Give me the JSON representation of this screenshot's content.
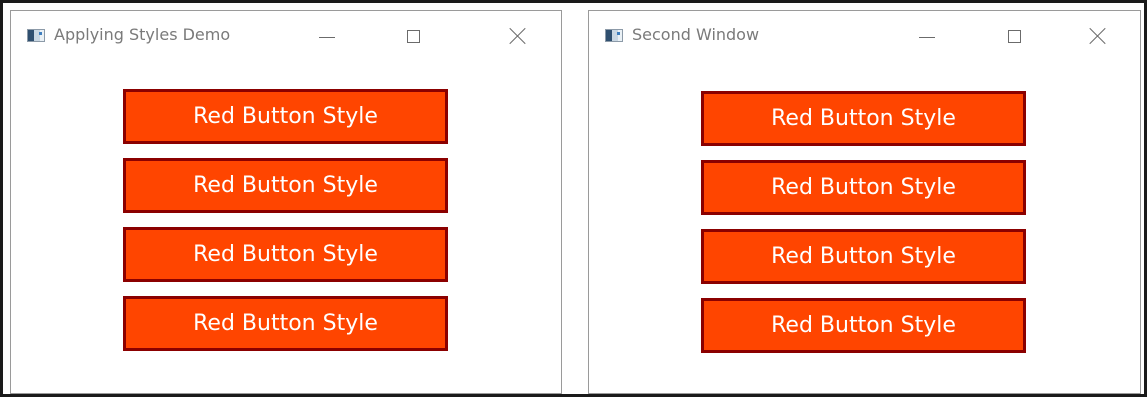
{
  "windows": [
    {
      "title": "Applying Styles Demo",
      "buttons": [
        {
          "label": "Red Button Style"
        },
        {
          "label": "Red Button Style"
        },
        {
          "label": "Red Button Style"
        },
        {
          "label": "Red Button Style"
        }
      ]
    },
    {
      "title": "Second Window",
      "buttons": [
        {
          "label": "Red Button Style"
        },
        {
          "label": "Red Button Style"
        },
        {
          "label": "Red Button Style"
        },
        {
          "label": "Red Button Style"
        }
      ]
    }
  ],
  "colors": {
    "button_fill": "#ff4500",
    "button_border": "#8b0000",
    "button_text": "#ffffff"
  },
  "icons": {
    "app": "app-window-icon",
    "minimize": "minimize-icon",
    "maximize": "maximize-icon",
    "close": "close-icon"
  }
}
